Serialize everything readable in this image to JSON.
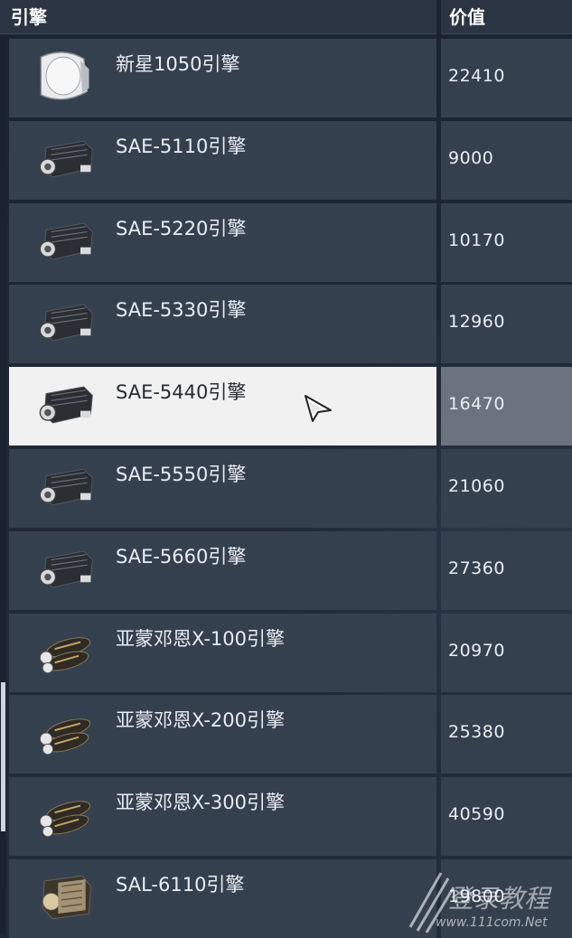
{
  "header": {
    "engine_col": "引擎",
    "value_col": "价值"
  },
  "rows": [
    {
      "name": "新星1050引擎",
      "value": "22410",
      "icon": "white-pod-engine-icon"
    },
    {
      "name": "SAE-5110引擎",
      "value": "9000",
      "icon": "dark-block-engine-icon"
    },
    {
      "name": "SAE-5220引擎",
      "value": "10170",
      "icon": "dark-block-engine-icon"
    },
    {
      "name": "SAE-5330引擎",
      "value": "12960",
      "icon": "dark-block-engine-icon"
    },
    {
      "name": "SAE-5440引擎",
      "value": "16470",
      "icon": "dark-block-engine-icon",
      "selected": true
    },
    {
      "name": "SAE-5550引擎",
      "value": "21060",
      "icon": "dark-block-engine-icon"
    },
    {
      "name": "SAE-5660引擎",
      "value": "27360",
      "icon": "dark-block-engine-icon"
    },
    {
      "name": "亚蒙邓恩X-100引擎",
      "value": "20970",
      "icon": "twin-thruster-engine-icon"
    },
    {
      "name": "亚蒙邓恩X-200引擎",
      "value": "25380",
      "icon": "twin-thruster-engine-icon"
    },
    {
      "name": "亚蒙邓恩X-300引擎",
      "value": "40590",
      "icon": "twin-thruster-engine-icon"
    },
    {
      "name": "SAL-6110引擎",
      "value": "19800",
      "icon": "tan-block-engine-icon"
    }
  ],
  "watermark": {
    "brand": "登录教程",
    "url": "www.111com.Net"
  }
}
